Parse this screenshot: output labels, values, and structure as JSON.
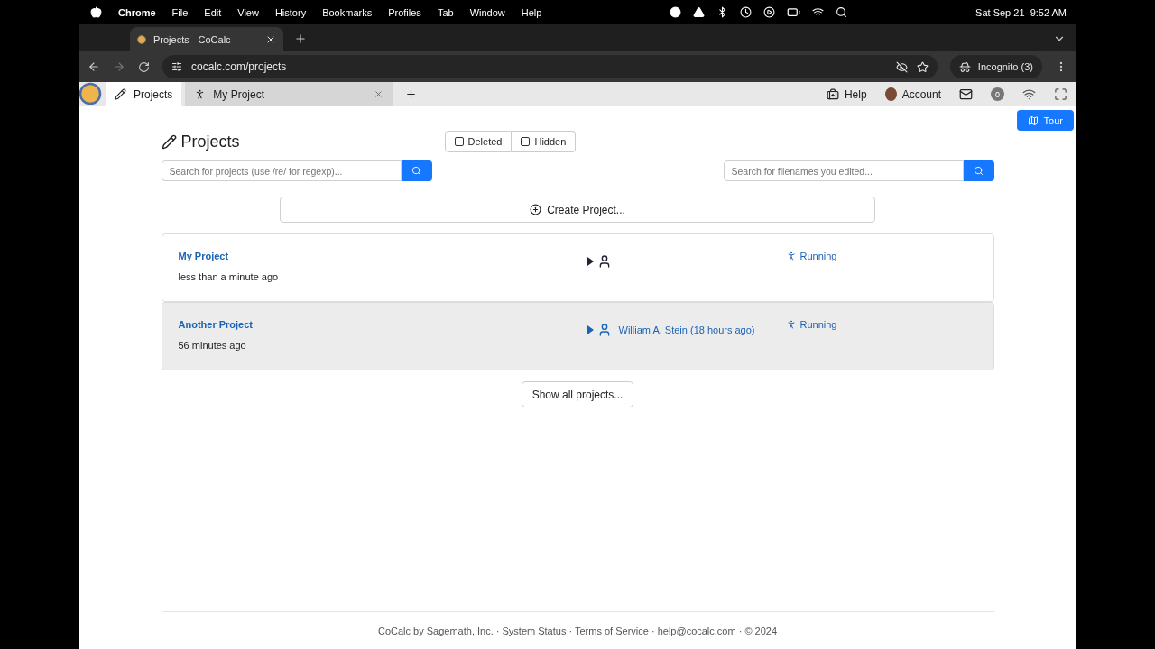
{
  "menubar": {
    "app": "Chrome",
    "menus": [
      "File",
      "Edit",
      "View",
      "History",
      "Bookmarks",
      "Profiles",
      "Tab",
      "Window",
      "Help"
    ],
    "clock": "Sat Sep 21  9:52 AM"
  },
  "browser": {
    "tab_title": "Projects - CoCalc",
    "address": "cocalc.com/projects",
    "profile": "Incognito (3)"
  },
  "app_tabs": [
    {
      "label": "Projects",
      "selected": true,
      "kind": "page"
    },
    {
      "label": "My Project",
      "selected": false,
      "kind": "project"
    }
  ],
  "header": {
    "help": "Help",
    "account": "Account",
    "notifications": "0"
  },
  "tour": "Tour",
  "title": "Projects",
  "filters": [
    {
      "label": "Deleted",
      "checked": false
    },
    {
      "label": "Hidden",
      "checked": false
    }
  ],
  "project_search": {
    "placeholder": "Search for projects (use /re/ for regexp)..."
  },
  "file_search": {
    "placeholder": "Search for filenames you edited..."
  },
  "create": "Create Project...",
  "projects": [
    {
      "name": "My Project",
      "time": "less than a minute ago",
      "status": "Running",
      "highlighted": false
    },
    {
      "name": "Another Project",
      "time": "56 minutes ago",
      "collaborator": "William A. Stein (18 hours ago)",
      "status": "Running",
      "highlighted": true
    }
  ],
  "show_all": "Show all projects...",
  "footer": "CoCalc by Sagemath, Inc. · System Status · Terms of Service · help@cocalc.com · © 2024"
}
